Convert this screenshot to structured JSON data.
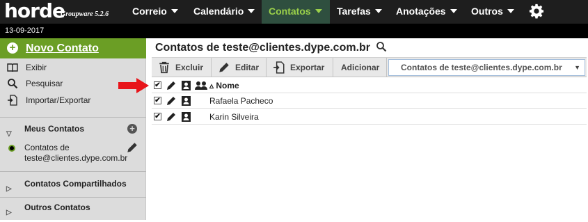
{
  "app": {
    "logo_text": "horde",
    "version": "Groupware 5.2.6",
    "date": "13-09-2017"
  },
  "nav": {
    "items": [
      {
        "label": "Correio",
        "active": false
      },
      {
        "label": "Calendário",
        "active": false
      },
      {
        "label": "Contatos",
        "active": true
      },
      {
        "label": "Tarefas",
        "active": false
      },
      {
        "label": "Anotações",
        "active": false
      },
      {
        "label": "Outros",
        "active": false
      }
    ],
    "settings_icon": "gear-icon"
  },
  "sidebar": {
    "new_contact": "Novo Contato",
    "links": [
      {
        "label": "Exibir",
        "icon": "book-icon"
      },
      {
        "label": "Pesquisar",
        "icon": "search-icon"
      },
      {
        "label": "Importar/Exportar",
        "icon": "import-export-icon"
      }
    ],
    "sections": {
      "my_contacts": "Meus Contatos",
      "shared_contacts": "Contatos Compartilhados",
      "other_contacts": "Outros Contatos"
    },
    "my_contacts_item": {
      "line1": "Contatos de",
      "line2": "teste@clientes.dype.com.br"
    }
  },
  "main": {
    "title": "Contatos de teste@clientes.dype.com.br",
    "toolbar": {
      "delete": "Excluir",
      "edit": "Editar",
      "export": "Exportar",
      "add": "Adicionar",
      "addressbook_selected": "Contatos de teste@clientes.dype.com.br"
    },
    "list": {
      "header_name": "Nome",
      "sort_indicator": "▵",
      "rows": [
        {
          "name": "Rafaela Pacheco",
          "checked": true
        },
        {
          "name": "Karin Silveira",
          "checked": true
        }
      ]
    }
  },
  "colors": {
    "accent_green": "#6b9e25",
    "active_nav_text": "#9bd04a",
    "arrow_red": "#e8151b"
  }
}
